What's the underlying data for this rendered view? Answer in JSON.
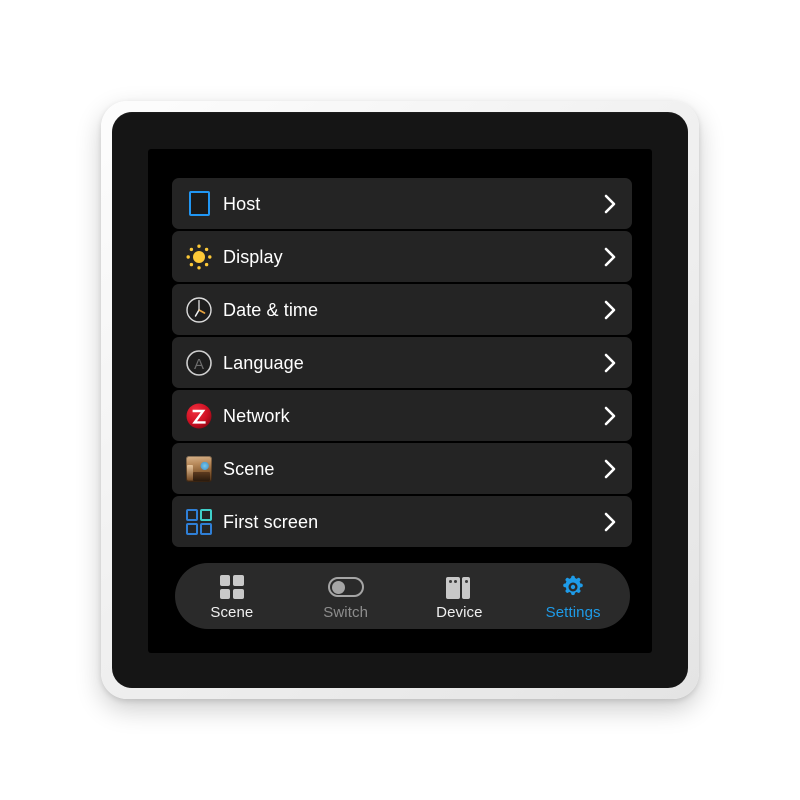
{
  "device": {
    "frame_color": "#f1f1f1",
    "bezel_color": "#151515",
    "screen_color": "#000000"
  },
  "theme": {
    "accent_blue": "#1e9be8",
    "row_background": "#242424",
    "row_text": "#ffffff",
    "tabbar_background": "#2a2a2a",
    "inactive_tab_text": "#8d8d8d",
    "host_icon_blue": "#2196f3",
    "sun_yellow": "#fdc937",
    "network_red": "#d8122a",
    "clock_hand_orange": "#e8a33d",
    "firstscreen_teal": "#3fd0c9"
  },
  "settings": {
    "rows": [
      {
        "label": "Host",
        "icon": "host-square-icon"
      },
      {
        "label": "Display",
        "icon": "sun-brightness-icon"
      },
      {
        "label": "Date & time",
        "icon": "clock-icon"
      },
      {
        "label": "Language",
        "icon": "letter-a-circle-icon"
      },
      {
        "label": "Network",
        "icon": "zigbee-z-logo-icon"
      },
      {
        "label": "Scene",
        "icon": "room-photo-thumbnail-icon"
      },
      {
        "label": "First screen",
        "icon": "four-square-grid-icon"
      }
    ],
    "chevron_icon": "chevron-right-icon"
  },
  "tabbar": {
    "tabs": [
      {
        "label": "Scene",
        "icon": "grid-icon",
        "state": "inactive"
      },
      {
        "label": "Switch",
        "icon": "toggle-icon",
        "state": "inactive-dim"
      },
      {
        "label": "Device",
        "icon": "device-panel-icon",
        "state": "inactive"
      },
      {
        "label": "Settings",
        "icon": "gear-icon",
        "state": "active"
      }
    ]
  }
}
